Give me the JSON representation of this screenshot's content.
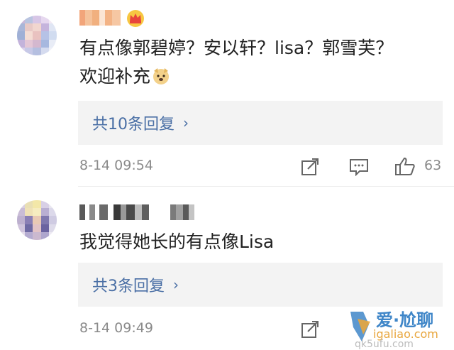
{
  "comments": [
    {
      "text_line1": "有点像郭碧婷？安以轩？lisa？郭雪芙？",
      "text_line2": "欢迎补充",
      "reply_link": "共10条回复",
      "timestamp": "8-14 09:54",
      "like_count": "63",
      "badge_icon": "crown-icon",
      "emoji_icon": "doge-icon"
    },
    {
      "text": "我觉得她长的有点像Lisa",
      "reply_link": "共3条回复",
      "timestamp": "8-14 09:49"
    }
  ],
  "watermark": {
    "title": "爱·尬聊",
    "url": "igaliao.com",
    "url2": "qk5ufu.com"
  },
  "colors": {
    "link": "#4a6fa5",
    "meta": "#8a8a8a",
    "reply_bg": "#f3f3f3",
    "text": "#222222"
  }
}
